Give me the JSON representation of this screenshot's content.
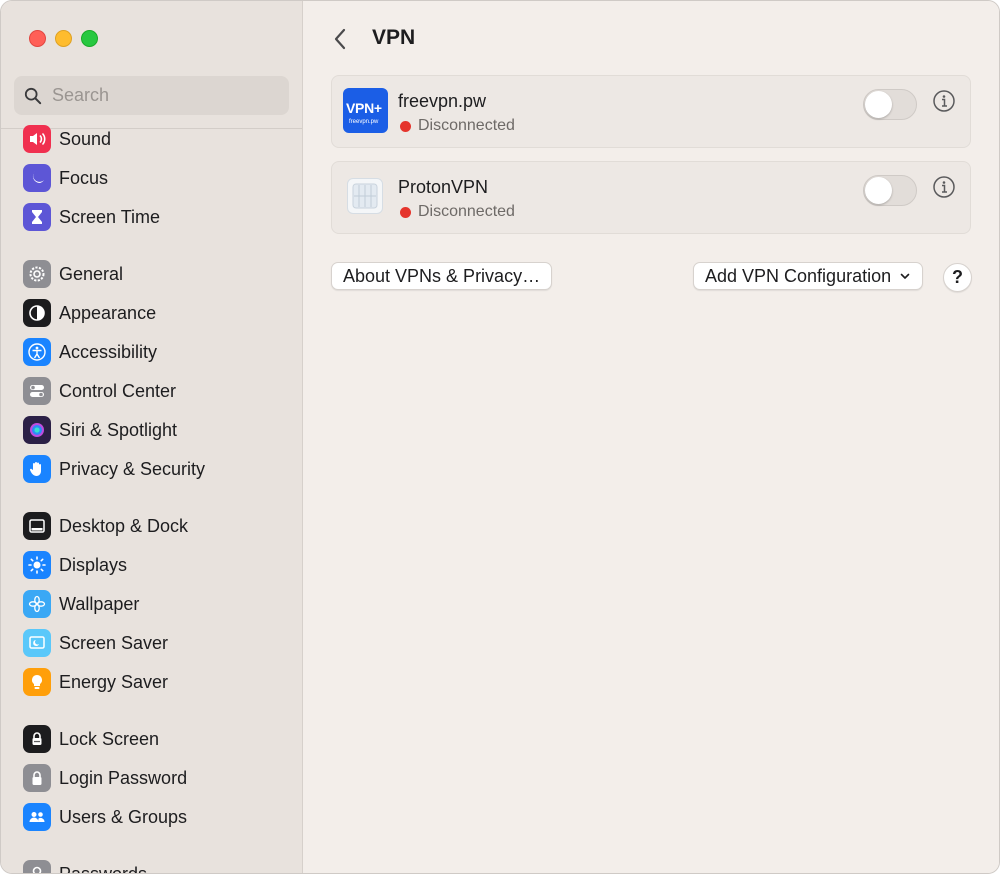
{
  "window": {
    "traffic_lights": [
      "close",
      "minimize",
      "zoom"
    ]
  },
  "search": {
    "placeholder": "Search",
    "icon": "search-icon"
  },
  "sidebar": {
    "items": [
      {
        "label": "Sound",
        "icon": "speaker-icon",
        "color": "#f0304f"
      },
      {
        "label": "Focus",
        "icon": "moon-icon",
        "color": "#5d56d6"
      },
      {
        "label": "Screen Time",
        "icon": "hourglass-icon",
        "color": "#5d56d6"
      },
      {
        "label": "General",
        "icon": "gear-icon",
        "color": "#8e8e93"
      },
      {
        "label": "Appearance",
        "icon": "appearance-icon",
        "color": "#1c1c1e"
      },
      {
        "label": "Accessibility",
        "icon": "accessibility-icon",
        "color": "#1a84ff"
      },
      {
        "label": "Control Center",
        "icon": "toggles-icon",
        "color": "#8e8e93"
      },
      {
        "label": "Siri & Spotlight",
        "icon": "siri-icon",
        "color": "#2b2046"
      },
      {
        "label": "Privacy & Security",
        "icon": "hand-icon",
        "color": "#1a84ff"
      },
      {
        "label": "Desktop & Dock",
        "icon": "dock-icon",
        "color": "#1c1c1e"
      },
      {
        "label": "Displays",
        "icon": "sun-icon",
        "color": "#1a84ff"
      },
      {
        "label": "Wallpaper",
        "icon": "flower-icon",
        "color": "#3aa8f5"
      },
      {
        "label": "Screen Saver",
        "icon": "screensaver-icon",
        "color": "#5ac8fa"
      },
      {
        "label": "Energy Saver",
        "icon": "lightbulb-icon",
        "color": "#ff9f0a"
      },
      {
        "label": "Lock Screen",
        "icon": "lock-screen-icon",
        "color": "#1c1c1e"
      },
      {
        "label": "Login Password",
        "icon": "padlock-icon",
        "color": "#8e8e93"
      },
      {
        "label": "Users & Groups",
        "icon": "users-icon",
        "color": "#1a84ff"
      },
      {
        "label": "Passwords",
        "icon": "key-icon",
        "color": "#8e8e93"
      }
    ]
  },
  "main": {
    "title": "VPN",
    "vpns": [
      {
        "name": "freevpn.pw",
        "status": "Disconnected",
        "icon_text": "VPN+",
        "icon_subtext": "freevpn.pw",
        "enabled": false
      },
      {
        "name": "ProtonVPN",
        "status": "Disconnected",
        "enabled": false
      }
    ],
    "about_button": "About VPNs & Privacy…",
    "add_button": "Add VPN Configuration",
    "help_button": "?"
  },
  "colors": {
    "status_disconnected": "#e5342c",
    "sidebar_bg": "#e8e2dd",
    "content_bg": "#f3eeea"
  }
}
